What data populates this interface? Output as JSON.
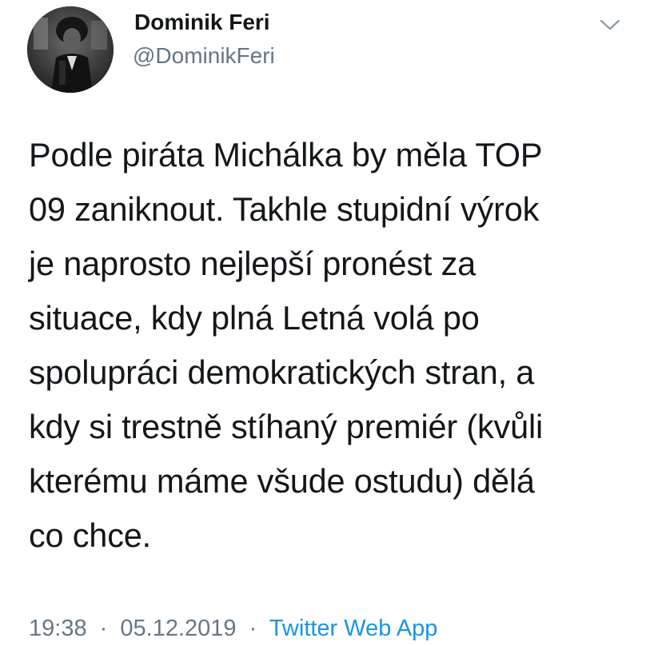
{
  "author": {
    "display_name": "Dominik Feri",
    "handle": "@DominikFeri"
  },
  "tweet": {
    "lines": [
      "Podle piráta Michálka by měla TOP",
      "09 zaniknout. Takhle stupidní výrok",
      "je naprosto nejlepší pronést za",
      "situace, kdy plná Letná volá po",
      "spolupráci demokratických stran, a",
      "kdy si trestně stíhaný premiér (kvůli",
      "kterému máme všude ostudu) dělá",
      "co chce."
    ]
  },
  "meta": {
    "time": "19:38",
    "separator": "·",
    "date": "05.12.2019",
    "source": "Twitter Web App"
  },
  "icons": {
    "menu": "chevron-down-icon",
    "avatar": "avatar"
  },
  "colors": {
    "text": "#14171a",
    "secondary": "#657786",
    "link": "#1b95e0"
  }
}
